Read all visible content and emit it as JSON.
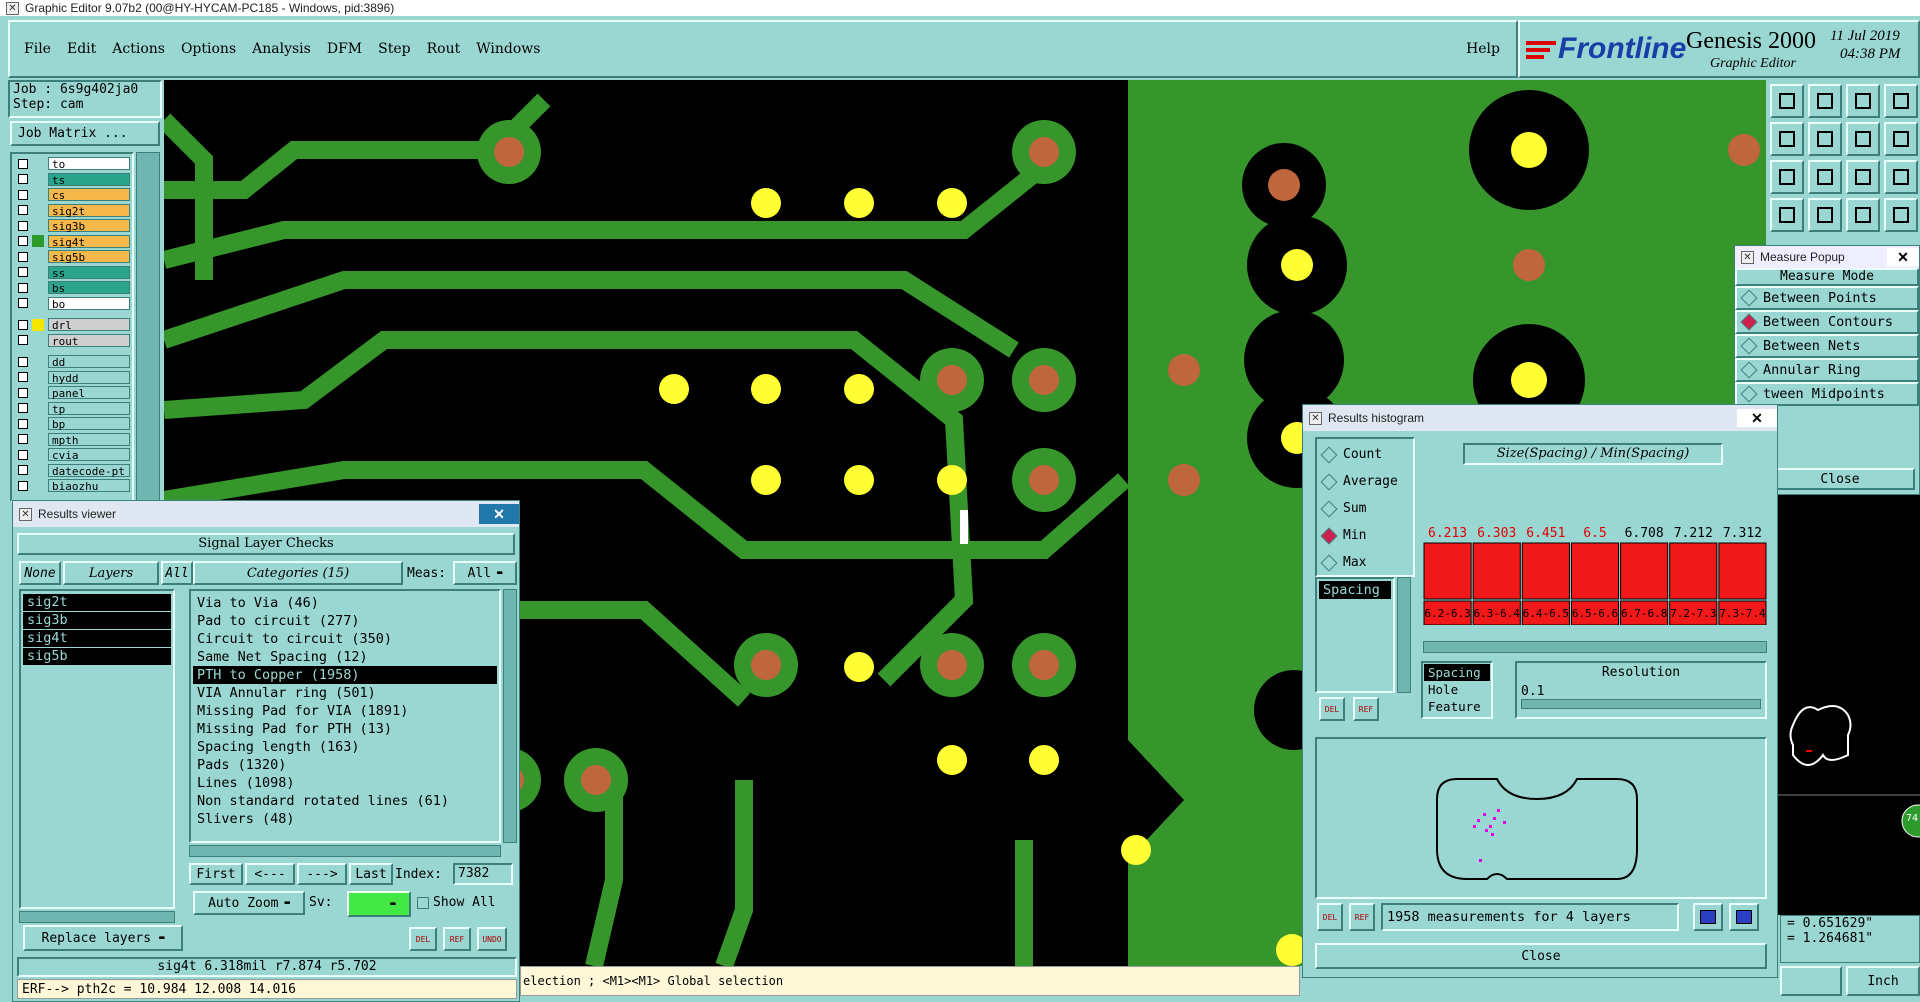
{
  "window": {
    "title": "Graphic Editor 9.07b2 (00@HY-HYCAM-PC185 - Windows, pid:3896)"
  },
  "menu": {
    "items": [
      "File",
      "Edit",
      "Actions",
      "Options",
      "Analysis",
      "DFM",
      "Step",
      "Rout",
      "Windows"
    ],
    "help": "Help"
  },
  "branding": {
    "logo": "Frontline",
    "product": "Genesis 2000",
    "subtitle": "Graphic Editor",
    "date": "11 Jul 2019",
    "time": "04:38 PM"
  },
  "job": {
    "job_label": "Job : 6s9g402ja0",
    "step_label": "Step: cam",
    "matrix_button": "Job Matrix ..."
  },
  "layers": [
    {
      "name": "to",
      "color": "#ffffff",
      "indicator": "#9ad7d3"
    },
    {
      "name": "ts",
      "color": "#2aa58c",
      "indicator": "#9ad7d3"
    },
    {
      "name": "cs",
      "color": "#f5b84a",
      "indicator": "#9ad7d3"
    },
    {
      "name": "sig2t",
      "color": "#f5b84a",
      "indicator": "#9ad7d3"
    },
    {
      "name": "sig3b",
      "color": "#f5b84a",
      "indicator": "#9ad7d3"
    },
    {
      "name": "sig4t",
      "color": "#f5b84a",
      "indicator": "#2c9b2c"
    },
    {
      "name": "sig5b",
      "color": "#f5b84a",
      "indicator": "#9ad7d3"
    },
    {
      "name": "ss",
      "color": "#2aa58c",
      "indicator": "#9ad7d3"
    },
    {
      "name": "bs",
      "color": "#2aa58c",
      "indicator": "#9ad7d3"
    },
    {
      "name": "bo",
      "color": "#ffffff",
      "indicator": "#9ad7d3"
    },
    {
      "name": "drl",
      "color": "#cfcfcf",
      "indicator": "#f5e600"
    },
    {
      "name": "rout",
      "color": "#cfcfcf",
      "indicator": "#9ad7d3"
    },
    {
      "name": "dd",
      "color": "#9ad7d3",
      "indicator": "#9ad7d3"
    },
    {
      "name": "hydd",
      "color": "#9ad7d3",
      "indicator": "#9ad7d3"
    },
    {
      "name": "panel",
      "color": "#9ad7d3",
      "indicator": "#9ad7d3"
    },
    {
      "name": "tp",
      "color": "#9ad7d3",
      "indicator": "#9ad7d3"
    },
    {
      "name": "bp",
      "color": "#9ad7d3",
      "indicator": "#9ad7d3"
    },
    {
      "name": "mpth",
      "color": "#9ad7d3",
      "indicator": "#9ad7d3"
    },
    {
      "name": "cvia",
      "color": "#9ad7d3",
      "indicator": "#9ad7d3"
    },
    {
      "name": "datecode-pt",
      "color": "#9ad7d3",
      "indicator": "#9ad7d3"
    },
    {
      "name": "biaozhu",
      "color": "#9ad7d3",
      "indicator": "#9ad7d3"
    }
  ],
  "results_viewer": {
    "title": "Results viewer",
    "header": "Signal Layer Checks",
    "buttons": {
      "none": "None",
      "layers": "Layers",
      "all": "All"
    },
    "categories_label": "Categories (15)",
    "meas_label": "Meas:",
    "meas_value": "All",
    "layers": [
      "sig2t",
      "sig3b",
      "sig4t",
      "sig5b"
    ],
    "categories": [
      "Via to Via (46)",
      "Pad to circuit (277)",
      "Circuit to circuit (350)",
      "Same Net Spacing (12)",
      "PTH to Copper (1958)",
      "VIA Annular ring (501)",
      "Missing Pad for VIA (1891)",
      "Missing Pad for PTH (13)",
      "Spacing length (163)",
      "Pads (1320)",
      "Lines (1098)",
      "Non standard rotated lines (61)",
      "Slivers (48)"
    ],
    "selected_category": 4,
    "nav": {
      "first": "First",
      "prev": "<---",
      "next": "--->",
      "last": "Last",
      "index_label": "Index:",
      "index_value": "7382"
    },
    "auto_zoom": "Auto Zoom",
    "sv_label": "Sv:",
    "show_all": "Show All",
    "replace_layers": "Replace layers",
    "del": "DEL",
    "ref": "REF",
    "undo": "UNDO",
    "status": "sig4t 6.318mil  r7.874  r5.702",
    "erf": "ERF--> pth2c = 10.984 12.008 14.016"
  },
  "histogram": {
    "title": "Results histogram",
    "modes": [
      "Count",
      "Average",
      "Sum",
      "Min",
      "Max"
    ],
    "selected_mode": "Min",
    "header": "Size(Spacing) / Min(Spacing)",
    "size_list": [
      "Spacing"
    ],
    "bins": [
      "6.2-6.3",
      "6.3-6.4",
      "6.4-6.5",
      "6.5-6.6",
      "6.7-6.8",
      "7.2-7.3",
      "7.3-7.4"
    ],
    "values": [
      "6.213",
      "6.303",
      "6.451",
      "6.5",
      "6.708",
      "7.212",
      "7.312"
    ],
    "value_colors": [
      "#e00000",
      "#e00000",
      "#e00000",
      "#e00000",
      "#000000",
      "#000000",
      "#000000"
    ],
    "spacing_options": [
      "Spacing",
      "Hole",
      "Feature"
    ],
    "resolution_label": "Resolution",
    "resolution_value": "0.1",
    "summary": "1958 measurements for 4 layers",
    "close": "Close",
    "del": "DEL",
    "ref": "REF"
  },
  "measure_popup": {
    "title": "Measure Popup",
    "mode_label": "Measure Mode",
    "modes": [
      "Between Points",
      "Between Contours",
      "Between Nets",
      "Annular Ring",
      "tween Midpoints"
    ],
    "selected_mode": 1,
    "close": "Close"
  },
  "command_line": {
    "text": "election ; <M1><M1> Global selection"
  },
  "coords": {
    "x": "= 0.651629\"",
    "y": "= 1.264681\"",
    "units": "Inch"
  },
  "right_badge": "74"
}
